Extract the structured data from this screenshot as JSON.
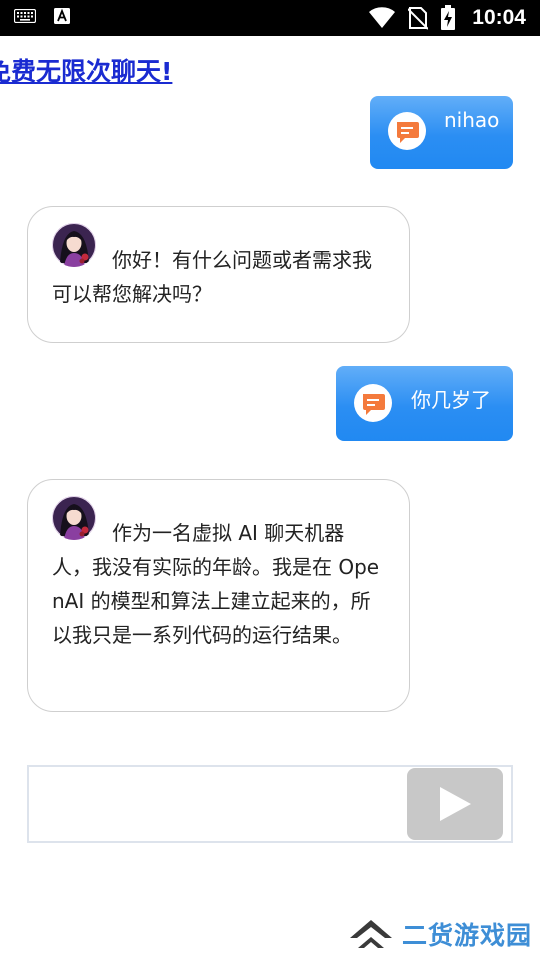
{
  "status_bar": {
    "time": "10:04",
    "icons": [
      "keyboard-icon",
      "text-a-icon",
      "wifi-icon",
      "no-sim-icon",
      "battery-charging-icon"
    ]
  },
  "header": {
    "title": "免费无限次聊天!",
    "color": "#1a2bd1"
  },
  "messages": [
    {
      "role": "user",
      "text": "nihao",
      "icon": "chat-bubble-icon"
    },
    {
      "role": "assistant",
      "text": "你好！有什么问题或者需求我可以帮您解决吗？",
      "avatar": "assistant-avatar"
    },
    {
      "role": "user",
      "text": "你几岁了",
      "icon": "chat-bubble-icon"
    },
    {
      "role": "assistant",
      "text": "作为一名虚拟 AI 聊天机器人，我没有实际的年龄。我是在 OpenAI 的模型和算法上建立起来的，所以我只是一系列代码的运行结果。",
      "avatar": "assistant-avatar"
    }
  ],
  "composer": {
    "value": "",
    "send_icon": "play-triangle-icon"
  },
  "watermark": {
    "text": "二货游戏园"
  },
  "colors": {
    "user_bubble": "#2189f2",
    "chat_icon_orange": "#f47a3c",
    "send_button": "#c8c8c8",
    "input_border": "#dde3ec",
    "watermark_text": "#3e8ed6"
  }
}
